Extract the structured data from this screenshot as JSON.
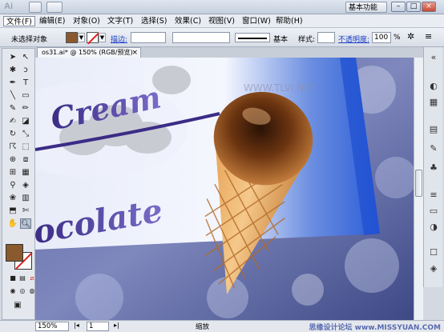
{
  "app": {
    "logo": "Ai",
    "workspace": "基本功能"
  },
  "menu": [
    "文件(F)",
    "编辑(E)",
    "对象(O)",
    "文字(T)",
    "选择(S)",
    "效果(C)",
    "视图(V)",
    "窗口(W)",
    "帮助(H)"
  ],
  "controlbar": {
    "selection_label": "未选择对象",
    "stroke_label": "描边:",
    "stroke_style": "基本",
    "style_label": "样式:",
    "opacity_label": "不透明度:",
    "opacity_value": "100",
    "opacity_unit": "%"
  },
  "document": {
    "tab_title": "os31.ai* @ 150% (RGB/预览)",
    "close": "×"
  },
  "artwork": {
    "top_text": "Cream",
    "bottom_text": "ocolate",
    "watermark": "WWW.TLVI.NET"
  },
  "status": {
    "zoom": "150%",
    "page": "1",
    "label": "缩放",
    "watermark": "思缘设计论坛  www.MISSYUAN.COM"
  },
  "colors": {
    "fill": "#8a5a2e",
    "stroke_none_slash": "#d8201b",
    "chrome": "#e4e8ee"
  }
}
